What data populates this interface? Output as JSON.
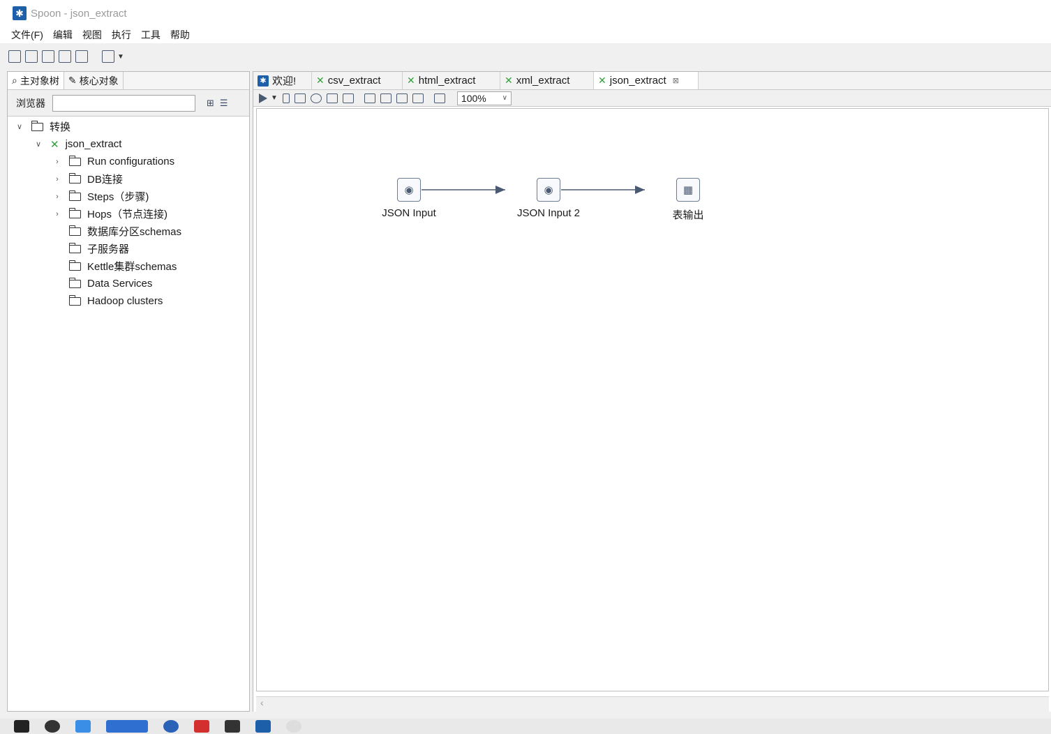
{
  "window": {
    "title": "Spoon - json_extract"
  },
  "menu": [
    "文件(F)",
    "编辑",
    "视图",
    "执行",
    "工具",
    "帮助"
  ],
  "left_panel": {
    "tabs": [
      {
        "label": "主对象树",
        "icon": "tree-icon"
      },
      {
        "label": "核心对象",
        "icon": "pencil-icon"
      }
    ],
    "browse_label": "浏览器",
    "search_value": "",
    "tree": {
      "root": "转换",
      "transformation": "json_extract",
      "items": [
        {
          "label": "Run configurations",
          "expandable": true
        },
        {
          "label": "DB连接",
          "expandable": true
        },
        {
          "label": "Steps（步骤)",
          "expandable": true
        },
        {
          "label": "Hops（节点连接)",
          "expandable": true
        },
        {
          "label": "数据库分区schemas",
          "expandable": false
        },
        {
          "label": "子服务器",
          "expandable": false
        },
        {
          "label": "Kettle集群schemas",
          "expandable": false
        },
        {
          "label": "Data Services",
          "expandable": false
        },
        {
          "label": "Hadoop clusters",
          "expandable": false
        }
      ]
    }
  },
  "editor": {
    "tabs": [
      {
        "label": "欢迎!",
        "icon": "spoon-icon",
        "active": false
      },
      {
        "label": "csv_extract",
        "icon": "transformation-icon",
        "active": false
      },
      {
        "label": "html_extract",
        "icon": "transformation-icon",
        "active": false
      },
      {
        "label": "xml_extract",
        "icon": "transformation-icon",
        "active": false
      },
      {
        "label": "json_extract",
        "icon": "transformation-icon",
        "active": true,
        "closable": true
      }
    ],
    "zoom": "100%",
    "steps": [
      {
        "label": "JSON Input",
        "icon": "json-input-icon"
      },
      {
        "label": "JSON Input 2",
        "icon": "json-input-icon"
      },
      {
        "label": "表输出",
        "icon": "table-output-icon"
      }
    ]
  },
  "colors": {
    "hop": "#4a5a72",
    "transformation_icon": "#2ea43a",
    "spoon_brand": "#1d5fa8"
  }
}
